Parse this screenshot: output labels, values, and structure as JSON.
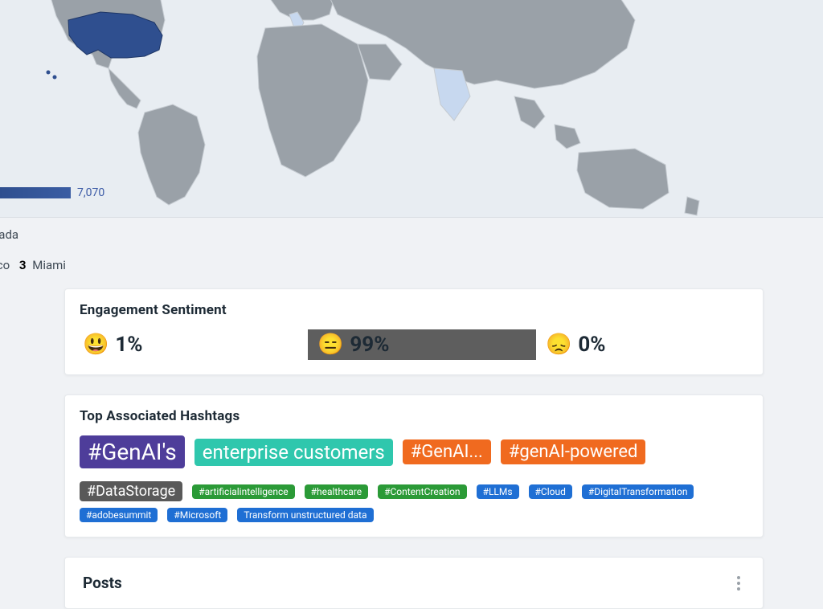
{
  "map": {
    "legend_value": "7,070"
  },
  "locations": {
    "row1_fragment": "nada",
    "row2_fragment": "sco",
    "row2_rank": "3",
    "row2_city": "Miami"
  },
  "sentiment": {
    "title": "Engagement Sentiment",
    "positive_emoji": "😃",
    "positive_pct": "1%",
    "neutral_emoji": "😑",
    "neutral_pct": "99%",
    "negative_emoji": "😞",
    "negative_pct": "0%"
  },
  "hashtags": {
    "title": "Top Associated Hashtags",
    "tags": [
      {
        "label": "#GenAI's",
        "size": "xl",
        "color": "purple"
      },
      {
        "label": "enterprise customers",
        "size": "lg",
        "color": "teal"
      },
      {
        "label": "#GenAI...",
        "size": "md",
        "color": "orange"
      },
      {
        "label": "#genAI-powered",
        "size": "md",
        "color": "orange"
      },
      {
        "label": "#DataStorage",
        "size": "sm",
        "color": "grey"
      },
      {
        "label": "#artificialintelligence",
        "size": "xs",
        "color": "green"
      },
      {
        "label": "#healthcare",
        "size": "xs",
        "color": "green"
      },
      {
        "label": "#ContentCreation",
        "size": "xs",
        "color": "green"
      },
      {
        "label": "#LLMs",
        "size": "xs",
        "color": "blue"
      },
      {
        "label": "#Cloud",
        "size": "xs",
        "color": "blue"
      },
      {
        "label": "#DigitalTransformation",
        "size": "xs",
        "color": "blue"
      },
      {
        "label": "#adobesummit",
        "size": "xs",
        "color": "blue"
      },
      {
        "label": "#Microsoft",
        "size": "xs",
        "color": "blue"
      },
      {
        "label": "Transform unstructured data",
        "size": "xs",
        "color": "blue"
      }
    ]
  },
  "posts": {
    "title": "Posts"
  }
}
